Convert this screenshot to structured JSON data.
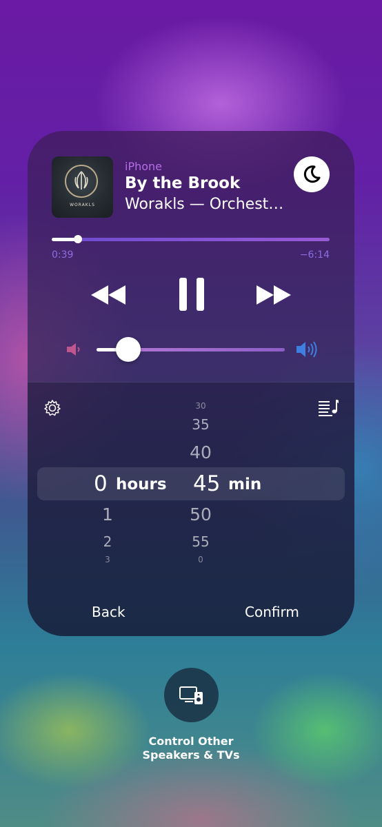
{
  "now_playing": {
    "device": "iPhone",
    "title": "By the Brook",
    "artist": "Worakls — Orchest…",
    "artwork_text": "WORAKLS",
    "elapsed": "0:39",
    "remaining": "−6:14",
    "progress_fraction": 0.095,
    "volume_fraction": 0.17
  },
  "sleep_timer": {
    "hours_above": [
      "",
      ""
    ],
    "minutes_above": [
      "30",
      "35",
      "40"
    ],
    "selected_hours": "0",
    "hours_unit": "hours",
    "selected_minutes": "45",
    "minutes_unit": "min",
    "hours_below": [
      "1",
      "2",
      "3"
    ],
    "minutes_below": [
      "50",
      "55",
      "0"
    ],
    "back_label": "Back",
    "confirm_label": "Confirm"
  },
  "airplay": {
    "label": "Control Other\nSpeakers & TVs"
  },
  "icons": {
    "sleep": "moon-icon",
    "previous": "rewind-icon",
    "play_pause": "pause-icon",
    "next": "fast-forward-icon",
    "volume_low": "speaker-low-icon",
    "volume_high": "speaker-high-icon",
    "settings": "gear-icon",
    "queue": "music-list-icon",
    "airplay": "airplay-speaker-icon"
  },
  "colors": {
    "device_label": "#b46fe3",
    "time_label": "#8b6ee0",
    "volume_icon_low": "#c0568e",
    "volume_icon_high": "#3f7fe0"
  }
}
